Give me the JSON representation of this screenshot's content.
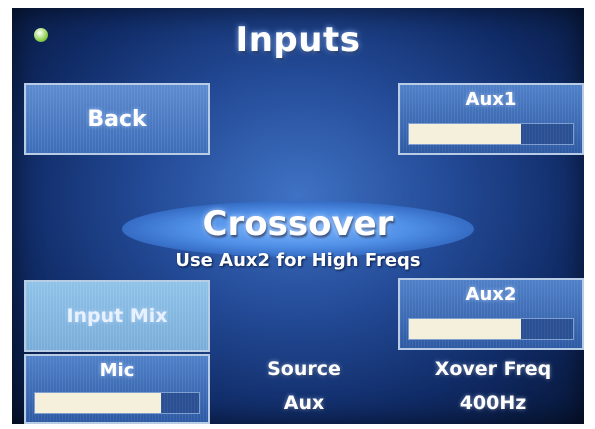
{
  "header": {
    "title": "Inputs",
    "status_color": "#8fd14f"
  },
  "back_button": {
    "label": "Back"
  },
  "aux1": {
    "label": "Aux1",
    "level": 0.68
  },
  "crossover": {
    "title": "Crossover",
    "hint": "Use Aux2 for High Freqs"
  },
  "input_mix_button": {
    "label": "Input Mix"
  },
  "aux2": {
    "label": "Aux2",
    "level": 0.68
  },
  "mic": {
    "label": "Mic",
    "level": 0.77
  },
  "source": {
    "label": "Source",
    "value": "Aux"
  },
  "xover_freq": {
    "label": "Xover Freq",
    "value": "400Hz"
  }
}
